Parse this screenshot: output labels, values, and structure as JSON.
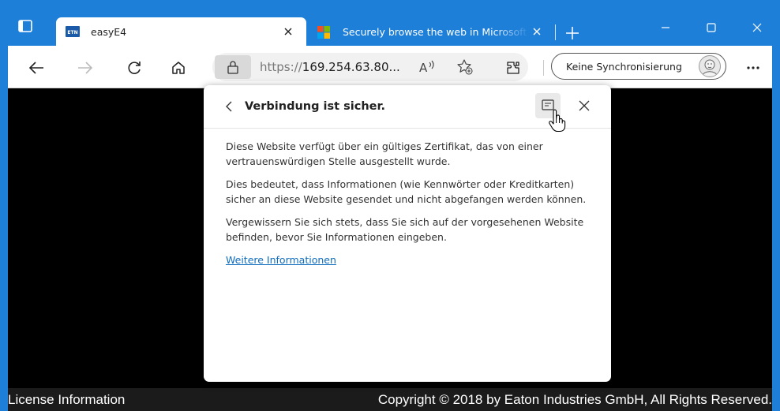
{
  "browser": {
    "tabs": [
      {
        "favicon": "eaton-logo-icon",
        "favicon_text": "ETN",
        "title": "easyE4",
        "active": true
      },
      {
        "favicon": "microsoft-logo-icon",
        "title": "Securely browse the web in Microsoft Edge",
        "active": false
      }
    ],
    "address_bar": {
      "scheme": "https://",
      "host": "169.254.63.80...",
      "lock_icon": "lock-icon"
    },
    "sync_button_label": "Keine Synchronisierung",
    "accent_color": "#1e7fd9"
  },
  "popup": {
    "title": "Verbindung ist sicher.",
    "paragraphs": [
      "Diese Website verfügt über ein gültiges Zertifikat, das von einer vertrauenswürdigen Stelle ausgestellt wurde.",
      "Dies bedeutet, dass Informationen (wie Kennwörter oder Kreditkarten) sicher an diese Website gesendet und nicht abgefangen werden können.",
      "Vergewissern Sie sich stets, dass Sie sich auf der vorgesehenen Website befinden, bevor Sie Informationen eingeben."
    ],
    "link": "Weitere Informationen",
    "link_color": "#0f6cbd"
  },
  "page": {
    "footer_left": "License Information",
    "footer_right": "Copyright © 2018 by Eaton Industries GmbH, All Rights Reserved."
  }
}
